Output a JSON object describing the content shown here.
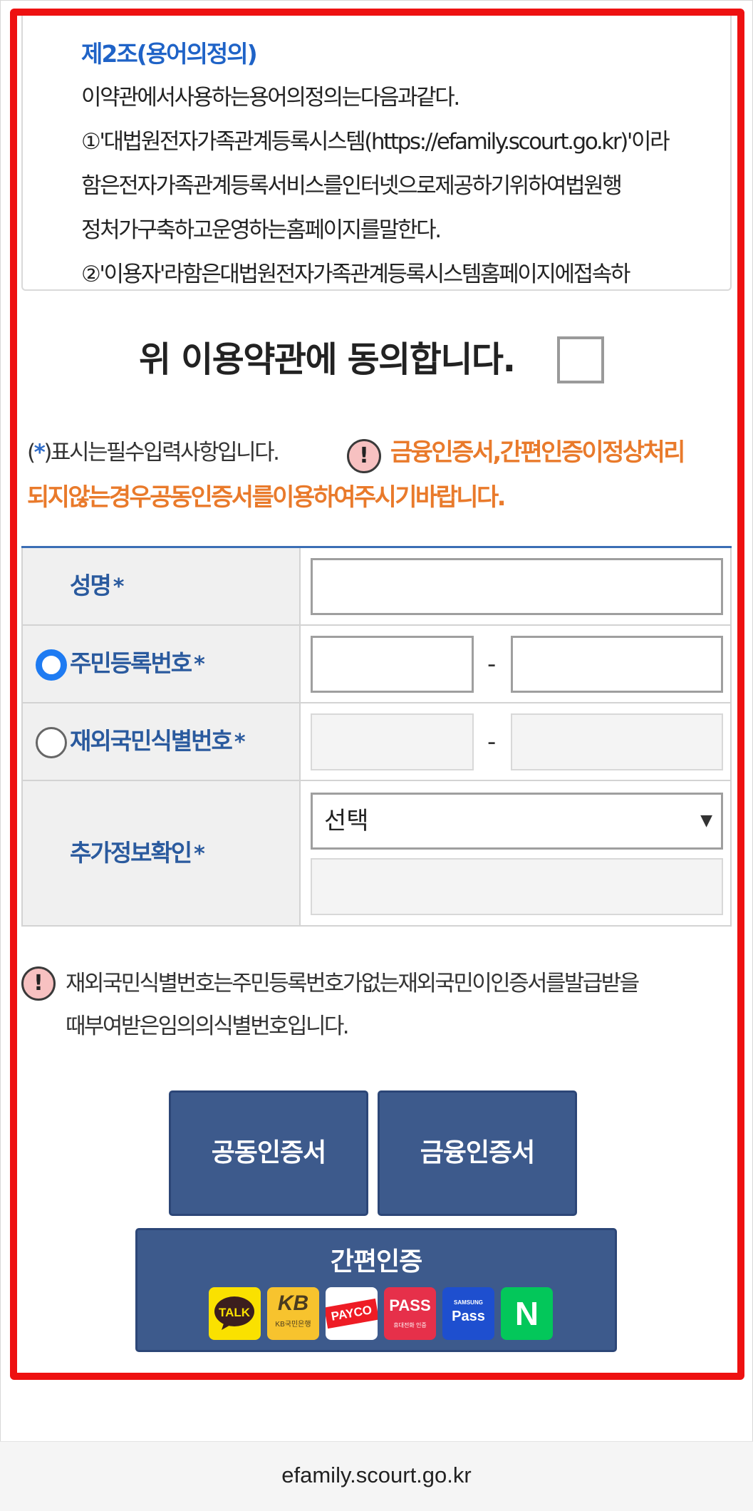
{
  "terms": {
    "heading": "제2조(용어의정의)",
    "lines": [
      "이약관에서사용하는용어의정의는다음과같다.",
      "①'대법원전자가족관계등록시스템(https://efamily.scourt.go.kr)'이라",
      "함은전자가족관계등록서비스를인터넷으로제공하기위하여법원행",
      "정처가구축하고운영하는홈페이지를말한다.",
      "②'이용자'라함은대법원전자가족관계등록시스템홈페이지에접속하"
    ]
  },
  "agreement": {
    "label": "위 이용약관에 동의합니다.",
    "checked": false
  },
  "notice": {
    "required_star": "*",
    "required_prefix": "(",
    "required_suffix": ")표시는필수입력사항입니다.",
    "warning_line1": "금융인증서,간편인증이정상처리",
    "warning_line2": "되지않는경우공동인증서를이용하여주시기바랍니다."
  },
  "form": {
    "required_mark": "*",
    "name_label": "성명",
    "rrn_label": "주민등록번호",
    "foreign_id_label": "재외국민식별번호",
    "extra_label": "추가정보확인",
    "dash": "-",
    "select_value": "선택",
    "select_arrow": "▼",
    "id_type_selected": "rrn"
  },
  "footnote": {
    "icon": "!",
    "line1": "재외국민식별번호는주민등록번호가없는재외국민이인증서를발급받을",
    "line2": "때부여받은임의의식별번호입니다."
  },
  "buttons": {
    "joint_cert": "공동인증서",
    "financial_cert": "금융인증서",
    "simple_auth": "간편인증"
  },
  "auth_providers": [
    {
      "name": "TALK",
      "bg": "#fae100",
      "fg": "#3b1e1e"
    },
    {
      "name": "KB",
      "sub": "KB국민은행",
      "bg": "#f7c32e",
      "fg": "#4a3b1f"
    },
    {
      "name": "PAYCO",
      "bg": "#ffffff",
      "fg": "#ee1c25"
    },
    {
      "name": "PASS",
      "sub": "휴대전화 인증",
      "bg": "#e6304a",
      "fg": "#ffffff"
    },
    {
      "name": "Pass",
      "sub": "SAMSUNG",
      "bg": "#1e4fcf",
      "fg": "#ffffff"
    },
    {
      "name": "N",
      "bg": "#03c75a",
      "fg": "#ffffff"
    }
  ],
  "url_bar": {
    "url": "efamily.scourt.go.kr"
  },
  "colors": {
    "highlight": "#ee1111",
    "accent_blue": "#2a5a9e",
    "warning_orange": "#e97a2b",
    "button": "#3d5a8c",
    "radio_on": "#1e7bf2"
  }
}
